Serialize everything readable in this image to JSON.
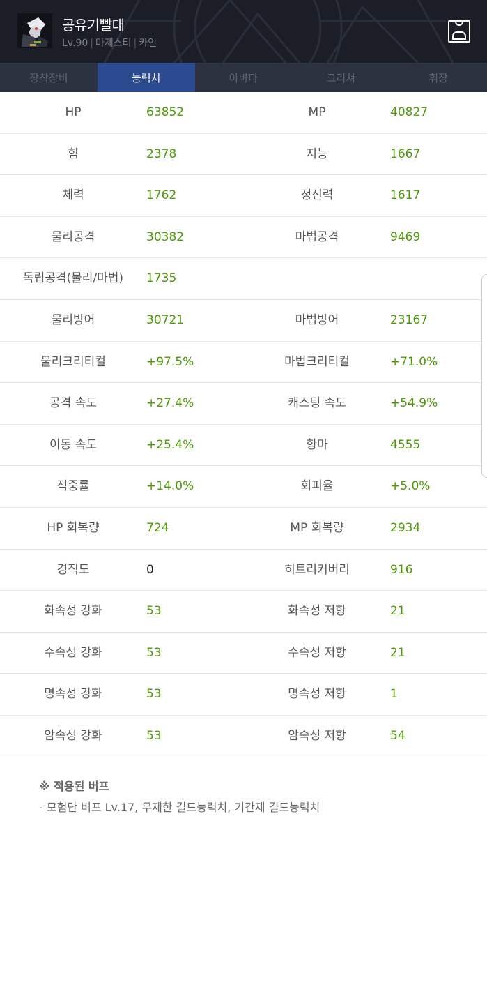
{
  "header": {
    "name": "공유기빨대",
    "level": "Lv.90",
    "class": "마제스티",
    "server": "카인"
  },
  "tabs": [
    {
      "label": "장착장비",
      "active": false
    },
    {
      "label": "능력치",
      "active": true
    },
    {
      "label": "아바타",
      "active": false
    },
    {
      "label": "크리쳐",
      "active": false
    },
    {
      "label": "휘장",
      "active": false
    }
  ],
  "stats": [
    {
      "l1": "HP",
      "v1": "63852",
      "l2": "MP",
      "v2": "40827"
    },
    {
      "l1": "힘",
      "v1": "2378",
      "l2": "지능",
      "v2": "1667"
    },
    {
      "l1": "체력",
      "v1": "1762",
      "l2": "정신력",
      "v2": "1617"
    },
    {
      "l1": "물리공격",
      "v1": "30382",
      "l2": "마법공격",
      "v2": "9469"
    },
    {
      "l1": "독립공격(물리/마법)",
      "v1": "1735",
      "l2": "",
      "v2": ""
    },
    {
      "l1": "물리방어",
      "v1": "30721",
      "l2": "마법방어",
      "v2": "23167"
    },
    {
      "l1": "물리크리티컬",
      "v1": "+97.5%",
      "l2": "마법크리티컬",
      "v2": "+71.0%"
    },
    {
      "l1": "공격 속도",
      "v1": "+27.4%",
      "l2": "캐스팅 속도",
      "v2": "+54.9%"
    },
    {
      "l1": "이동 속도",
      "v1": "+25.4%",
      "l2": "항마",
      "v2": "4555"
    },
    {
      "l1": "적중률",
      "v1": "+14.0%",
      "l2": "회피율",
      "v2": "+5.0%"
    },
    {
      "l1": "HP 회복량",
      "v1": "724",
      "l2": "MP 회복량",
      "v2": "2934"
    },
    {
      "l1": "경직도",
      "v1": "0",
      "l2": "히트리커버리",
      "v2": "916"
    },
    {
      "l1": "화속성 강화",
      "v1": "53",
      "l2": "화속성 저항",
      "v2": "21"
    },
    {
      "l1": "수속성 강화",
      "v1": "53",
      "l2": "수속성 저항",
      "v2": "21"
    },
    {
      "l1": "명속성 강화",
      "v1": "53",
      "l2": "명속성 저항",
      "v2": "1"
    },
    {
      "l1": "암속성 강화",
      "v1": "53",
      "l2": "암속성 저항",
      "v2": "54"
    }
  ],
  "buffs": {
    "title": "※ 적용된 버프",
    "text": "- 모험단 버프 Lv.17, 무제한 길드능력치, 기간제 길드능력치"
  },
  "icons": {
    "profile": "person-icon",
    "avatar": "character-avatar"
  },
  "colors": {
    "header_bg": "#1b1e27",
    "tab_bg": "#2c3240",
    "tab_active": "#2c4a8f",
    "value_green": "#4e9a06"
  }
}
